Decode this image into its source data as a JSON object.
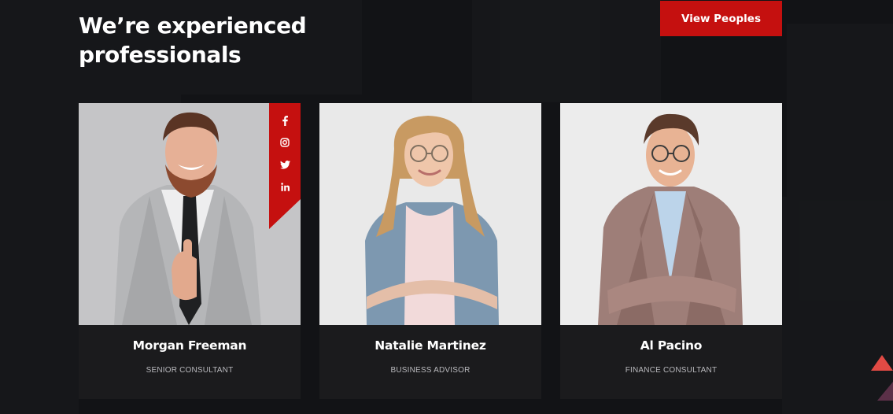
{
  "section": {
    "title": "We’re experienced professionals",
    "cta_label": "View Peoples"
  },
  "team": [
    {
      "name": "Morgan Freeman",
      "role": "SENIOR CONSULTANT"
    },
    {
      "name": "Natalie Martinez",
      "role": "BUSINESS ADVISOR"
    },
    {
      "name": "Al Pacino",
      "role": "FINANCE CONSULTANT"
    }
  ],
  "social": [
    "facebook-icon",
    "instagram-icon",
    "twitter-icon",
    "linkedin-icon"
  ],
  "colors": {
    "background": "#121316",
    "accent": "#c5100f",
    "card": "#1b1b1d",
    "text": "#ffffff",
    "muted": "#b9b9bd"
  }
}
